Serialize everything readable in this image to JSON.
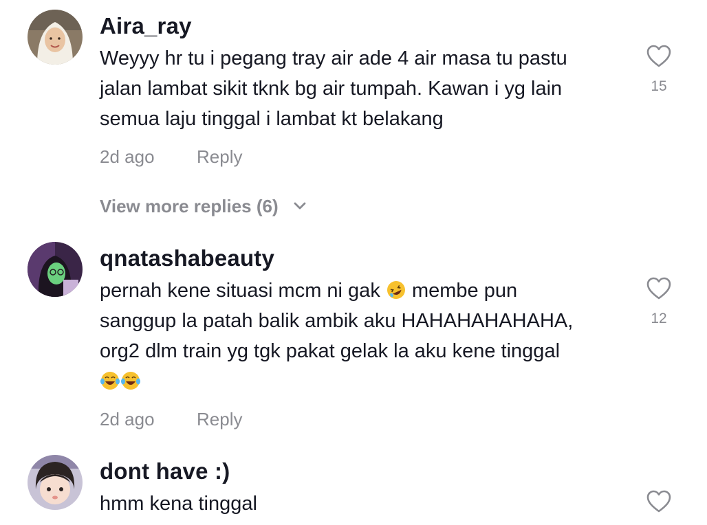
{
  "comments": [
    {
      "username": "Aira_ray",
      "lines": [
        "Weyyy hr tu i pegang tray air ade 4 air masa tu pastu",
        "jalan lambat sikit tknk bg air tumpah. Kawan i yg lain",
        "semua laju tinggal i lambat kt belakang"
      ],
      "time": "2d ago",
      "reply_label": "Reply",
      "likes": "15",
      "view_more": "View more replies (6)"
    },
    {
      "username": "qnatashabeauty",
      "line1_before_emoji": "pernah kene situasi mcm ni gak",
      "line1_after_emoji": "membe pun",
      "lines": [
        "sanggup la patah balik ambik aku HAHAHAHAHAHA,",
        "org2 dlm train yg tgk pakat gelak la aku kene tinggal"
      ],
      "time": "2d ago",
      "reply_label": "Reply",
      "likes": "12",
      "emoji_inline": "rofl-emoji",
      "emoji_trailing": "tears-of-joy-emoji"
    },
    {
      "username": "dont have :)",
      "lines": [
        "hmm kena tinggal"
      ]
    }
  ],
  "icons": {
    "like": "heart-outline-icon",
    "expand": "chevron-down-icon"
  },
  "colors": {
    "text_primary": "#161823",
    "text_secondary": "#8a8b91",
    "background": "#ffffff"
  }
}
